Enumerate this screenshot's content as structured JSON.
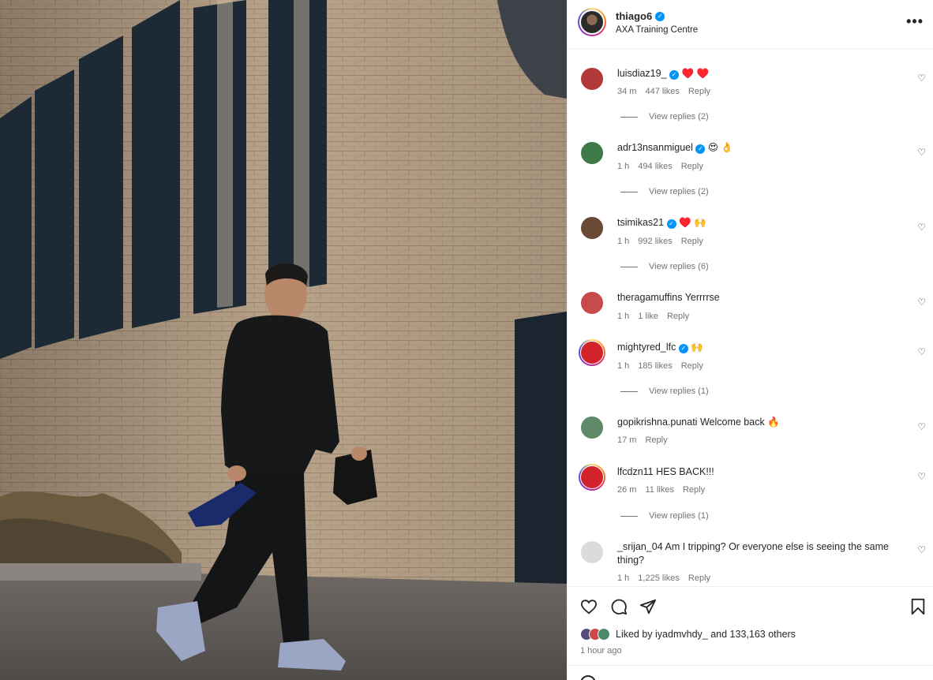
{
  "post": {
    "username": "thiago6",
    "location": "AXA Training Centre",
    "more_label": "•••"
  },
  "colors": {
    "verified": "#0095f6",
    "muted": "#737373",
    "text": "#262626"
  },
  "comments": [
    {
      "username": "luisdiaz19_",
      "verified": true,
      "text": "♥️ ♥️",
      "time": "34 m",
      "likes": "447 likes",
      "reply": "Reply",
      "view_replies": "View replies (2)",
      "avatar_color": "#b33a3a"
    },
    {
      "username": "adr13nsanmiguel",
      "verified": true,
      "text": "😍 👌",
      "time": "1 h",
      "likes": "494 likes",
      "reply": "Reply",
      "view_replies": "View replies (2)",
      "avatar_color": "#3f7a4a"
    },
    {
      "username": "tsimikas21",
      "verified": true,
      "text": "♥️ 🙌",
      "time": "1 h",
      "likes": "992 likes",
      "reply": "Reply",
      "view_replies": "View replies (6)",
      "avatar_color": "#6b4a35"
    },
    {
      "username": "theragamuffins",
      "verified": false,
      "text": "Yerrrrse",
      "time": "1 h",
      "likes": "1 like",
      "reply": "Reply",
      "view_replies": "",
      "avatar_color": "#c94a4a"
    },
    {
      "username": "mightyred_lfc",
      "verified": true,
      "text": "🙌",
      "time": "1 h",
      "likes": "185 likes",
      "reply": "Reply",
      "view_replies": "View replies (1)",
      "avatar_color": "#d2232a"
    },
    {
      "username": "gopikrishna.punati",
      "verified": false,
      "text": "Welcome back 🔥",
      "time": "17 m",
      "likes": "",
      "reply": "Reply",
      "view_replies": "",
      "avatar_color": "#5f8a6a"
    },
    {
      "username": "lfcdzn11",
      "verified": false,
      "text": "HES BACK!!!",
      "time": "26 m",
      "likes": "11 likes",
      "reply": "Reply",
      "view_replies": "View replies (1)",
      "avatar_color": "#d2232a"
    },
    {
      "username": "_srijan_04",
      "verified": false,
      "text": "Am I tripping? Or everyone else is seeing the same thing?",
      "time": "1 h",
      "likes": "1,225 likes",
      "reply": "Reply",
      "view_replies": "",
      "avatar_color": "#dbdbdb"
    }
  ],
  "footer": {
    "liked_by_prefix": "Liked by ",
    "liked_by_user": "iyadmvhdy_",
    "liked_by_suffix": " and 133,163 others",
    "time_ago": "1 hour ago"
  }
}
